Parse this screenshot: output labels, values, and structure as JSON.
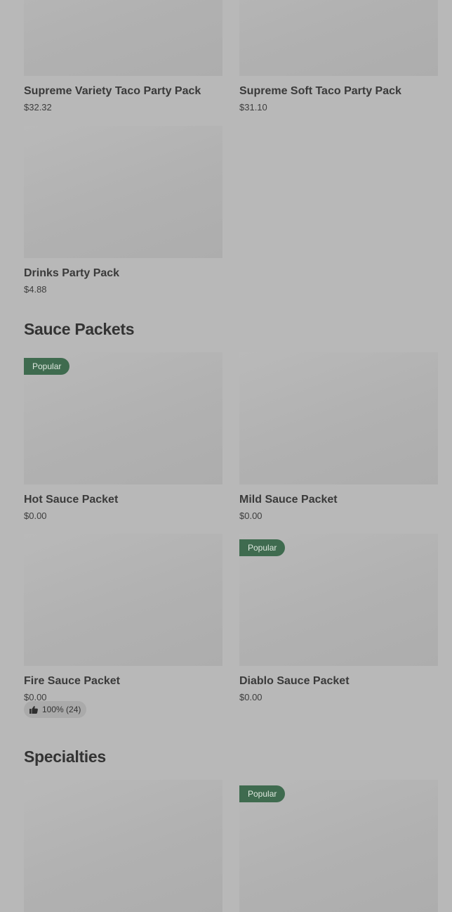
{
  "party_packs": {
    "items": [
      {
        "name": "Supreme Variety Taco Party Pack",
        "price": "$32.32"
      },
      {
        "name": "Supreme Soft Taco Party Pack",
        "price": "$31.10"
      },
      {
        "name": "Drinks Party Pack",
        "price": "$4.88"
      }
    ]
  },
  "sauce_packets": {
    "title": "Sauce Packets",
    "items": [
      {
        "name": "Hot Sauce Packet",
        "price": "$0.00",
        "badge": "Popular"
      },
      {
        "name": "Mild Sauce Packet",
        "price": "$0.00"
      },
      {
        "name": "Fire Sauce Packet",
        "price": "$0.00",
        "rating": "100% (24)",
        "rating_icon": "thumbs-up-icon"
      },
      {
        "name": "Diablo Sauce Packet",
        "price": "$0.00",
        "badge": "Popular"
      }
    ]
  },
  "specialties": {
    "title": "Specialties",
    "items": [
      {
        "badge": "Popular"
      }
    ]
  },
  "colors": {
    "background": "#b8b8b8",
    "badge_background": "#3f6b4f",
    "image_placeholder": "#b1b1b1"
  }
}
